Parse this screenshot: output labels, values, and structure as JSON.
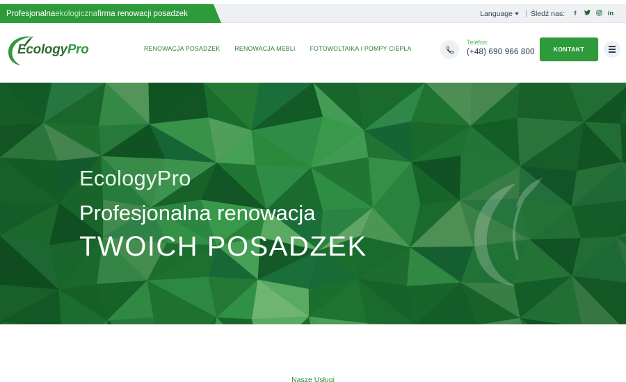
{
  "topbar": {
    "promo_part1": "Profesjonalna ",
    "promo_part2": "ekologiczna",
    "promo_part3": " firma renowacji posadzek",
    "language_label": "Language",
    "follow_label": "Śledź nas:",
    "social": [
      {
        "name": "facebook-icon",
        "glyph": "f"
      },
      {
        "name": "twitter-icon",
        "glyph": "t"
      },
      {
        "name": "instagram-icon",
        "glyph": "◎"
      },
      {
        "name": "linkedin-icon",
        "glyph": "in"
      }
    ]
  },
  "header": {
    "logo_text_1": "Ecology",
    "logo_text_2": "Pro",
    "nav": [
      "RENOWACJA POSADZEK",
      "RENOWACJA MEBLI",
      "FOTOWOLTAIKA I POMPY CIEPŁA"
    ],
    "phone_label": "Telefon:",
    "phone_number": "(+48) 690 966 800",
    "contact_button": "KONTAKT"
  },
  "hero": {
    "brand": "EcologyPro",
    "subtitle": "Profesjonalna renowacja",
    "title": "TWOICH POSADZEK"
  },
  "section": {
    "label": "Nasze Usługi"
  },
  "colors": {
    "brand_green": "#2e9b3a",
    "dark_green": "#2f6b35",
    "topbar_bg": "#eef1f4"
  }
}
